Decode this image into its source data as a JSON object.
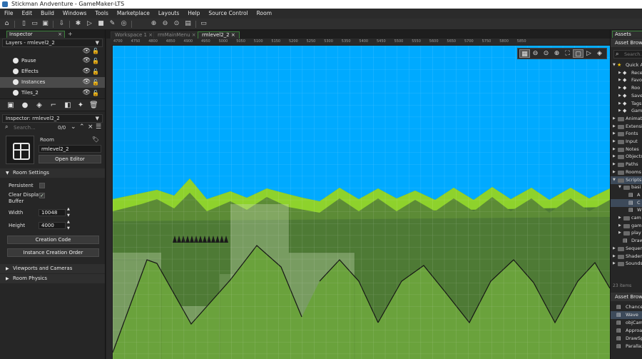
{
  "window": {
    "title": "Stickman Andventure - GameMaker-LTS"
  },
  "menu": [
    "File",
    "Edit",
    "Build",
    "Windows",
    "Tools",
    "Marketplace",
    "Layouts",
    "Help",
    "Source Control",
    "Room"
  ],
  "left": {
    "tab": "Inspector",
    "layers_dropdown": "Layers - rmlevel2_2",
    "layers": [
      {
        "name": "Pause"
      },
      {
        "name": "Effects"
      },
      {
        "name": "Instances",
        "selected": true
      },
      {
        "name": "Tiles_2"
      }
    ],
    "inspector_dropdown": "Inspector: rmlevel2_2",
    "search_placeholder": "Search...",
    "search_count": "0/0",
    "room_type": "Room",
    "room_name": "rmlevel2_2",
    "open_editor": "Open Editor",
    "room_settings": "Room Settings",
    "persistent": "Persistent",
    "clear_display_buffer_l1": "Clear Display",
    "clear_display_buffer_l2": "Buffer",
    "width_label": "Width",
    "width_value": "10048",
    "height_label": "Height",
    "height_value": "4000",
    "creation_code": "Creation Code",
    "instance_creation_order": "Instance Creation Order",
    "viewports": "Viewports and Cameras",
    "room_physics": "Room Physics"
  },
  "center": {
    "tabs": [
      {
        "label": "Workspace 1",
        "active": false
      },
      {
        "label": "rmMainMenu",
        "active": false
      },
      {
        "label": "rmlevel2_2",
        "active": true
      }
    ],
    "ruler": [
      "4700",
      "4750",
      "4800",
      "4850",
      "4900",
      "4950",
      "5000",
      "5050",
      "5100",
      "5150",
      "5200",
      "5250",
      "5300",
      "5350",
      "5400",
      "5450",
      "5500",
      "5550",
      "5600",
      "5650",
      "5700",
      "5750",
      "5800",
      "5850"
    ]
  },
  "right": {
    "tab": "Assets",
    "browser_header": "Asset Browse",
    "search_placeholder": "Search...",
    "items": [
      {
        "label": "Quick A",
        "indent": 0,
        "arrow": "▼",
        "kind": "star"
      },
      {
        "label": "Rece",
        "indent": 1,
        "arrow": "▶",
        "kind": "icon"
      },
      {
        "label": "Favo",
        "indent": 1,
        "arrow": "▶",
        "kind": "icon"
      },
      {
        "label": "Roo",
        "indent": 1,
        "arrow": "▶",
        "kind": "icon"
      },
      {
        "label": "Save",
        "indent": 1,
        "arrow": "▶",
        "kind": "icon"
      },
      {
        "label": "Tags",
        "indent": 1,
        "arrow": "▶",
        "kind": "icon"
      },
      {
        "label": "Gam",
        "indent": 1,
        "arrow": "▶",
        "kind": "icon"
      },
      {
        "label": "Animatio",
        "indent": 0,
        "arrow": "▶",
        "kind": "folder"
      },
      {
        "label": "Extensio",
        "indent": 0,
        "arrow": "▶",
        "kind": "folder"
      },
      {
        "label": "Fonts",
        "indent": 0,
        "arrow": "▶",
        "kind": "folder"
      },
      {
        "label": "Input",
        "indent": 0,
        "arrow": "▶",
        "kind": "folder"
      },
      {
        "label": "Notes",
        "indent": 0,
        "arrow": "▶",
        "kind": "folder"
      },
      {
        "label": "Objects",
        "indent": 0,
        "arrow": "▶",
        "kind": "folder"
      },
      {
        "label": "Paths",
        "indent": 0,
        "arrow": "▶",
        "kind": "folder"
      },
      {
        "label": "Rooms",
        "indent": 0,
        "arrow": "▶",
        "kind": "folder"
      },
      {
        "label": "Scripts",
        "indent": 0,
        "arrow": "▼",
        "kind": "folder",
        "selected": true
      },
      {
        "label": "basi",
        "indent": 1,
        "arrow": "▼",
        "kind": "folder"
      },
      {
        "label": "A",
        "indent": 2,
        "arrow": "",
        "kind": "script"
      },
      {
        "label": "C",
        "indent": 2,
        "arrow": "",
        "kind": "script",
        "selected": true
      },
      {
        "label": "W",
        "indent": 2,
        "arrow": "",
        "kind": "script"
      },
      {
        "label": "cam",
        "indent": 1,
        "arrow": "▶",
        "kind": "folder"
      },
      {
        "label": "gam",
        "indent": 1,
        "arrow": "▶",
        "kind": "folder"
      },
      {
        "label": "play",
        "indent": 1,
        "arrow": "▶",
        "kind": "folder"
      },
      {
        "label": "Draw",
        "indent": 1,
        "arrow": "",
        "kind": "script"
      },
      {
        "label": "Sequen",
        "indent": 0,
        "arrow": "▶",
        "kind": "folder"
      },
      {
        "label": "Shaders",
        "indent": 0,
        "arrow": "▶",
        "kind": "folder"
      },
      {
        "label": "Sounds",
        "indent": 0,
        "arrow": "▶",
        "kind": "folder"
      }
    ],
    "item_count": "23 items",
    "browser2_header": "Asset Browse",
    "items2": [
      {
        "label": "Chance",
        "selected": false
      },
      {
        "label": "Wave",
        "selected": true
      },
      {
        "label": "objCam",
        "selected": false
      },
      {
        "label": "Approa",
        "selected": false
      },
      {
        "label": "DrawSp",
        "selected": false
      },
      {
        "label": "Parallax",
        "selected": false
      }
    ]
  },
  "colors": {
    "sky": "#00aaff",
    "grass_light": "#8ed22c",
    "ground": "#4e7a35",
    "accent_tab": "#3c7f3c"
  }
}
